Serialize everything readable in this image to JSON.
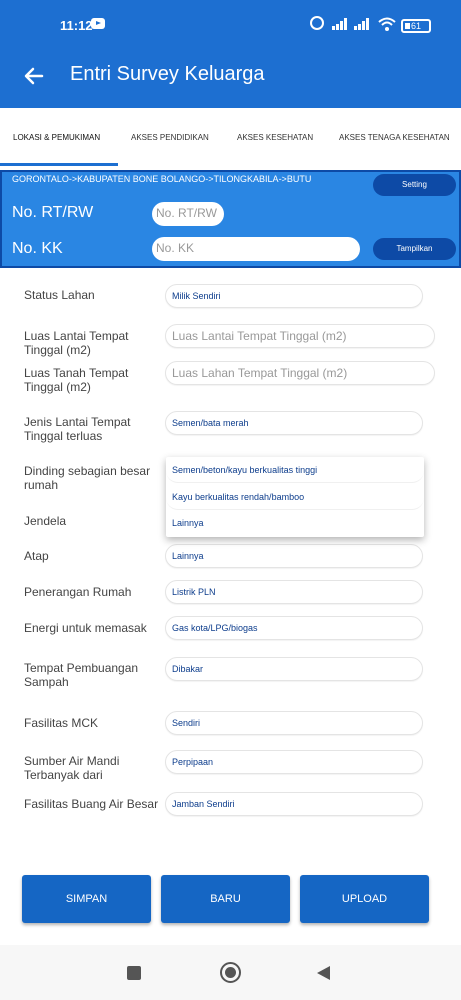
{
  "status_bar": {
    "time": "11:12",
    "battery": "61"
  },
  "app_bar": {
    "title": "Entri Survey Keluarga"
  },
  "tabs": [
    {
      "label": "LOKASI & PEMUKIMAN",
      "active": true
    },
    {
      "label": "AKSES PENDIDIKAN",
      "active": false
    },
    {
      "label": "AKSES KESEHATAN",
      "active": false
    },
    {
      "label": "AKSES TENAGA KESEHATAN",
      "active": false
    }
  ],
  "location": {
    "path": "GORONTALO->KABUPATEN BONE BOLANGO->TILONGKABILA->BUTU",
    "setting_label": "Setting",
    "rt_rw_label": "No. RT/RW",
    "rt_rw_placeholder": "No. RT/RW",
    "kk_label": "No. KK",
    "kk_placeholder": "No. KK",
    "show_label": "Tampilkan"
  },
  "form": [
    {
      "label": "Status Lahan",
      "value": "Milik Sendiri"
    },
    {
      "label": "Luas Lantai Tempat Tinggal (m2)",
      "placeholder": "Luas Lantai Tempat Tinggal (m2)"
    },
    {
      "label": "Luas Tanah Tempat Tinggal (m2)",
      "placeholder": "Luas Lahan Tempat Tinggal (m2)"
    },
    {
      "label": "Jenis Lantai Tempat Tinggal terluas",
      "value": "Semen/bata merah"
    },
    {
      "label": "Dinding sebagian besar rumah",
      "value": ""
    },
    {
      "label": "Jendela",
      "value": ""
    },
    {
      "label": "Atap",
      "value": "Lainnya"
    },
    {
      "label": "Penerangan Rumah",
      "value": "Listrik PLN"
    },
    {
      "label": "Energi untuk memasak",
      "value": "Gas kota/LPG/biogas"
    },
    {
      "label": "Tempat Pembuangan Sampah",
      "value": "Dibakar"
    },
    {
      "label": "Fasilitas MCK",
      "value": "Sendiri"
    },
    {
      "label": "Sumber Air Mandi Terbanyak dari",
      "value": "Perpipaan"
    },
    {
      "label": "Fasilitas Buang Air Besar",
      "value": "Jamban Sendiri"
    }
  ],
  "dropdown_options": [
    "Semen/beton/kayu berkualitas tinggi",
    "Kayu berkualitas rendah/bamboo",
    "Lainnya"
  ],
  "buttons": {
    "save": "SIMPAN",
    "new": "BARU",
    "upload": "UPLOAD"
  }
}
